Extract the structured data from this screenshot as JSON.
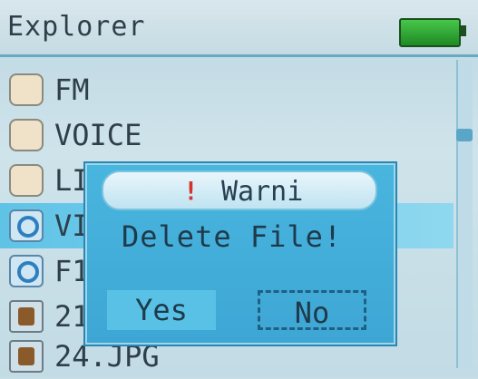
{
  "app": {
    "title": "Explorer"
  },
  "files": [
    {
      "name": "FM",
      "type": "folder"
    },
    {
      "name": "VOICE",
      "type": "folder"
    },
    {
      "name": "LI",
      "type": "folder"
    },
    {
      "name": "VI",
      "type": "video"
    },
    {
      "name": "F1",
      "type": "video"
    },
    {
      "name": "21",
      "type": "image"
    },
    {
      "name": "24.JPG",
      "type": "image"
    }
  ],
  "dialog": {
    "title": "Warni",
    "message": "Delete File!",
    "yes_label": "Yes",
    "no_label": "No"
  },
  "colors": {
    "accent": "#49b6df",
    "battery": "#2fa935"
  }
}
